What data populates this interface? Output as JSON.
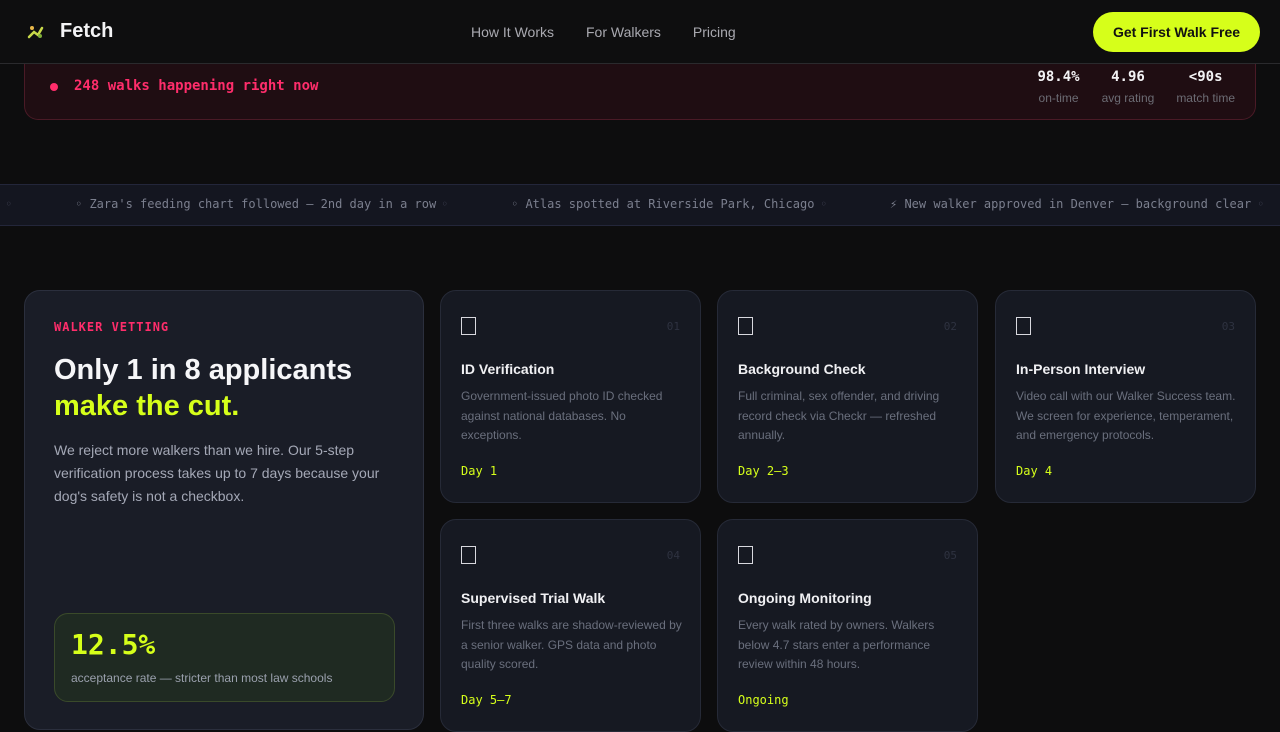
{
  "nav": {
    "brand": "Fetch",
    "brand_icon": "dog-paw-icon",
    "links": [
      "How It Works",
      "For Walkers",
      "Pricing"
    ],
    "cta": "Get First Walk Free"
  },
  "live": {
    "text": "248 walks happening right now",
    "stats": [
      {
        "value": "98.4%",
        "label": "on-time"
      },
      {
        "value": "4.96",
        "label": "avg rating"
      },
      {
        "value": "<90s",
        "label": "match time"
      }
    ]
  },
  "ticker": {
    "items": [
      "◦ Zara's feeding chart followed — 2nd day in a row",
      "◦ Atlas spotted at Riverside Park, Chicago",
      "⚡ New walker approved in Denver — background clear"
    ],
    "separator": "◦"
  },
  "vetting": {
    "eyebrow": "WALKER VETTING",
    "headline": "Only 1 in 8 applicants",
    "headline_accent": "make the cut.",
    "description": "We reject more walkers than we hire. Our 5-step verification process takes up to 7 days because your dog's safety is not a checkbox.",
    "rate_value": "12.5%",
    "rate_label": "acceptance rate — stricter than most law schools"
  },
  "steps": [
    {
      "num": "01",
      "title": "ID Verification",
      "desc": "Government-issued photo ID checked against national databases. No exceptions.",
      "day": "Day 1"
    },
    {
      "num": "02",
      "title": "Background Check",
      "desc": "Full criminal, sex offender, and driving record check via Checkr — refreshed annually.",
      "day": "Day 2–3"
    },
    {
      "num": "03",
      "title": "In-Person Interview",
      "desc": "Video call with our Walker Success team. We screen for experience, temperament, and emergency protocols.",
      "day": "Day 4"
    },
    {
      "num": "04",
      "title": "Supervised Trial Walk",
      "desc": "First three walks are shadow-reviewed by a senior walker. GPS data and photo quality scored.",
      "day": "Day 5–7"
    },
    {
      "num": "05",
      "title": "Ongoing Monitoring",
      "desc": "Every walk rated by owners. Walkers below 4.7 stars enter a performance review within 48 hours.",
      "day": "Ongoing"
    }
  ]
}
